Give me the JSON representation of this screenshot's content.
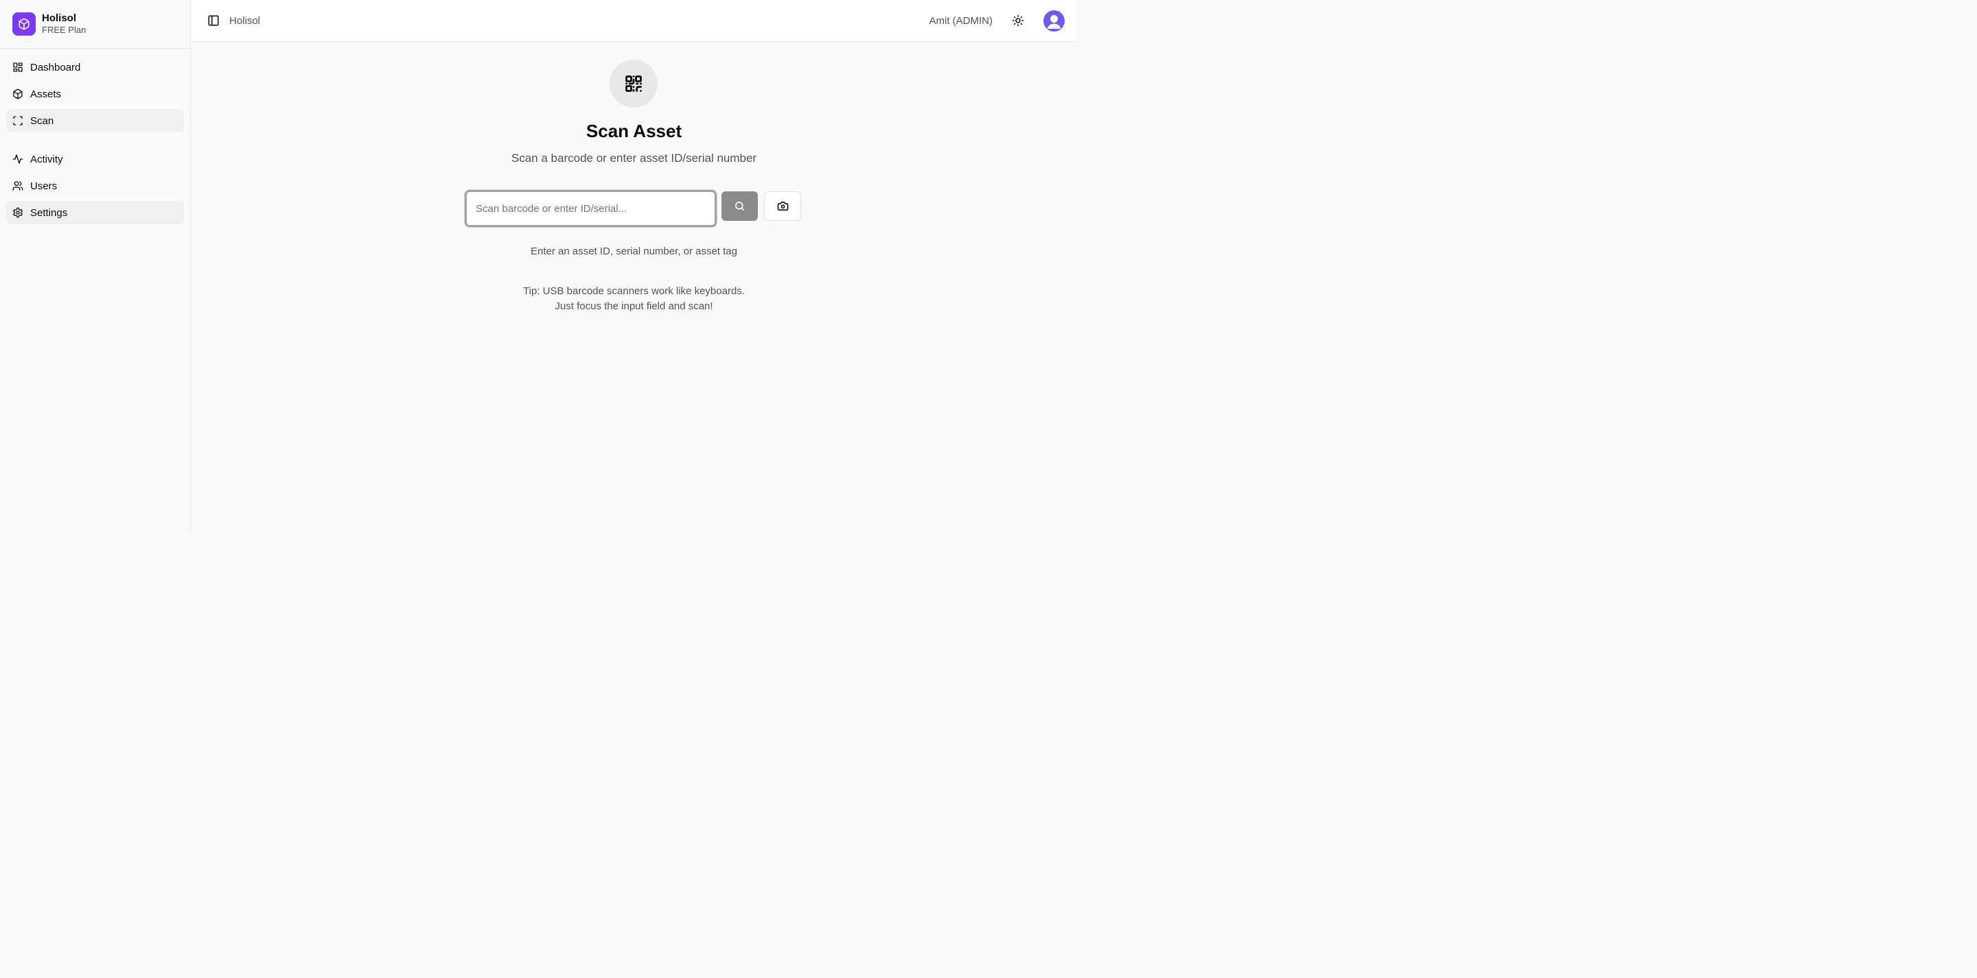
{
  "brand": {
    "name": "Holisol",
    "plan": "FREE Plan",
    "logo_icon": "box-icon",
    "accent": "#7c3aed"
  },
  "sidebar": {
    "groups": [
      {
        "items": [
          {
            "label": "Dashboard",
            "icon": "dashboard-icon",
            "active": false
          },
          {
            "label": "Assets",
            "icon": "box-icon",
            "active": false
          },
          {
            "label": "Scan",
            "icon": "scan-icon",
            "active": true
          }
        ]
      },
      {
        "items": [
          {
            "label": "Activity",
            "icon": "activity-icon",
            "active": false
          },
          {
            "label": "Users",
            "icon": "users-icon",
            "active": false
          },
          {
            "label": "Settings",
            "icon": "gear-icon",
            "active": true
          }
        ]
      }
    ]
  },
  "header": {
    "title": "Holisol",
    "user_label": "Amit (ADMIN)",
    "avatar_color": "#6d5ce8"
  },
  "main": {
    "icon": "qr-code-icon",
    "title": "Scan Asset",
    "subtitle": "Scan a barcode or enter asset ID/serial number",
    "input_placeholder": "Scan barcode or enter ID/serial...",
    "input_value": "",
    "hint": "Enter an asset ID, serial number, or asset tag",
    "tip_line1": "Tip: USB barcode scanners work like keyboards.",
    "tip_line2": "Just focus the input field and scan!"
  }
}
